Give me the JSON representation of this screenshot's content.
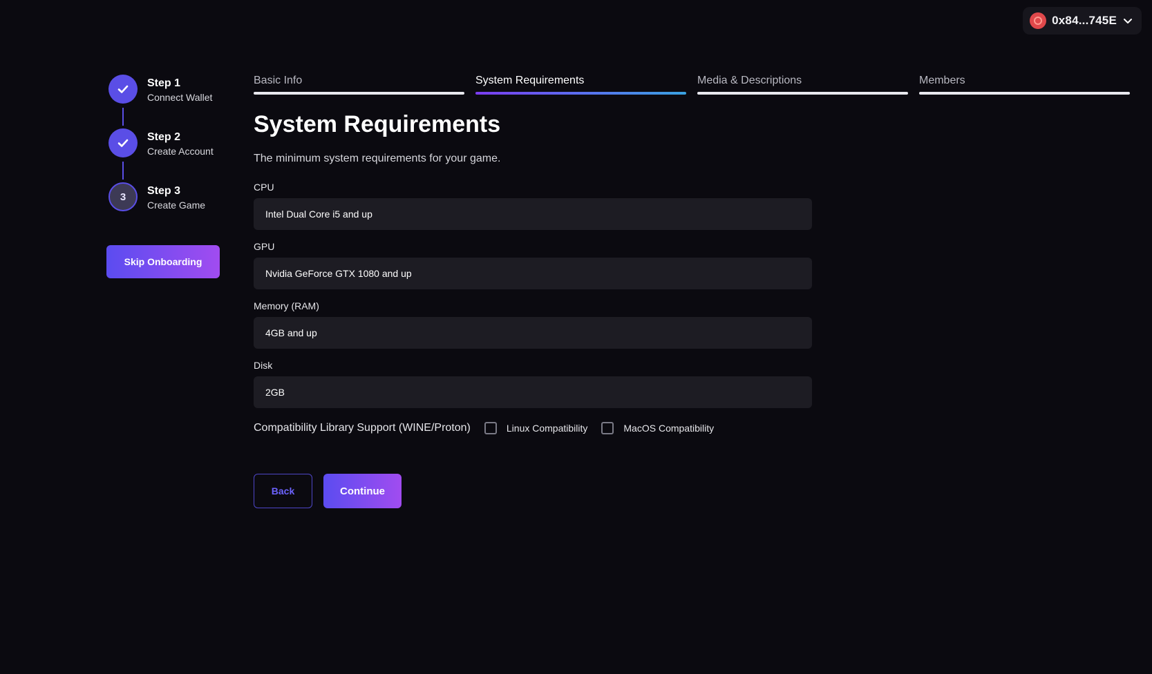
{
  "wallet": {
    "address": "0x84...745E",
    "avatar_icon": "wallet-avatar-icon",
    "chevron_icon": "chevron-down-icon"
  },
  "stepper": {
    "steps": [
      {
        "title": "Step 1",
        "subtitle": "Connect Wallet",
        "status": "done",
        "icon": "check-icon"
      },
      {
        "title": "Step 2",
        "subtitle": "Create Account",
        "status": "done",
        "icon": "check-icon"
      },
      {
        "title": "Step 3",
        "subtitle": "Create Game",
        "status": "current",
        "number": "3"
      }
    ],
    "skip_label": "Skip Onboarding"
  },
  "tabs": [
    {
      "label": "Basic Info",
      "active": false
    },
    {
      "label": "System Requirements",
      "active": true
    },
    {
      "label": "Media & Descriptions",
      "active": false
    },
    {
      "label": "Members",
      "active": false
    }
  ],
  "main": {
    "title": "System Requirements",
    "description": "The minimum system requirements for your game.",
    "fields": {
      "cpu": {
        "label": "CPU",
        "value": "Intel Dual Core i5 and up"
      },
      "gpu": {
        "label": "GPU",
        "value": "Nvidia GeForce GTX 1080 and up"
      },
      "memory": {
        "label": "Memory (RAM)",
        "value": "4GB and up"
      },
      "disk": {
        "label": "Disk",
        "value": "2GB"
      }
    },
    "compat": {
      "label": "Compatibility Library Support (WINE/Proton)",
      "linux_label": "Linux Compatibility",
      "linux_checked": false,
      "mac_label": "MacOS Compatibility",
      "mac_checked": false
    },
    "back_label": "Back",
    "continue_label": "Continue"
  },
  "colors": {
    "background": "#0b0a10",
    "accent": "#5a4ee6",
    "gradient_start": "#5b4cf0",
    "gradient_end": "#a14cf0",
    "input_bg": "#1d1c23"
  }
}
